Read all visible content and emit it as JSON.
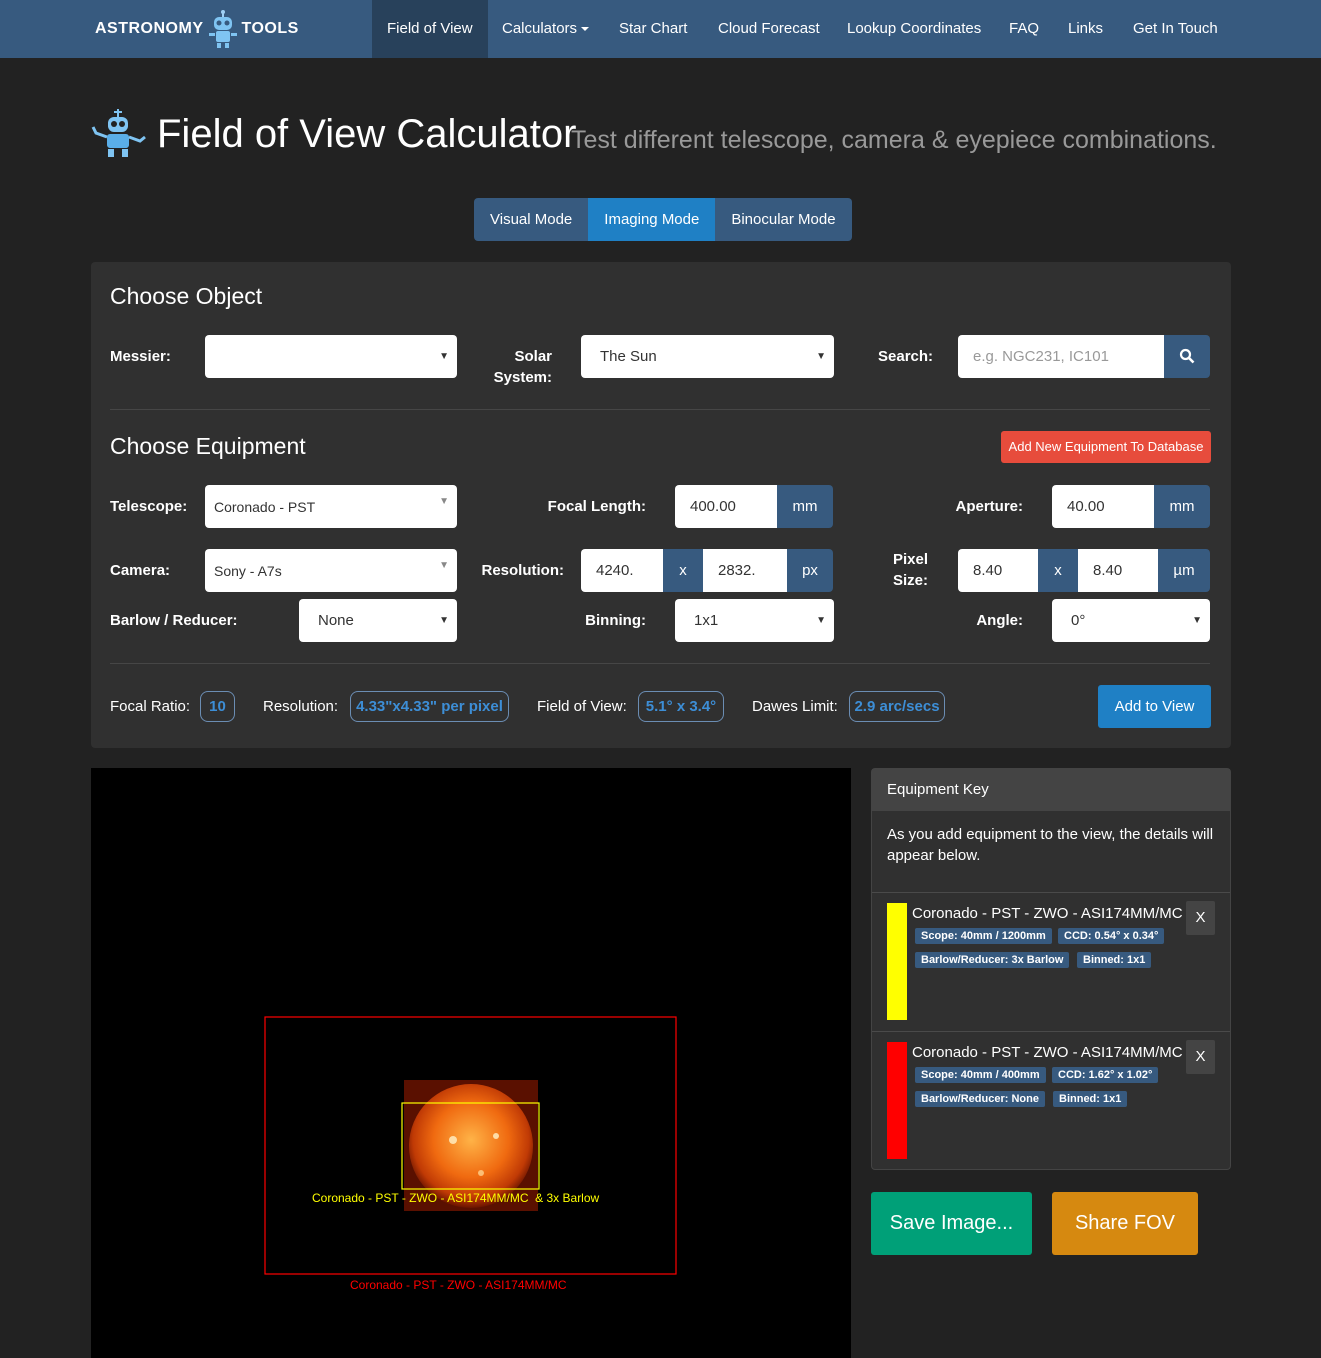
{
  "nav": {
    "brand_left": "ASTRONOMY",
    "brand_right": "TOOLS",
    "items": [
      {
        "label": "Field of View"
      },
      {
        "label": "Calculators"
      },
      {
        "label": "Star Chart"
      },
      {
        "label": "Cloud Forecast"
      },
      {
        "label": "Lookup Coordinates"
      },
      {
        "label": "FAQ"
      },
      {
        "label": "Links"
      },
      {
        "label": "Get In Touch"
      }
    ]
  },
  "header": {
    "title": "Field of View Calculator",
    "subtitle": "Test different telescope, camera & eyepiece combinations."
  },
  "modes": [
    "Visual Mode",
    "Imaging Mode",
    "Binocular Mode"
  ],
  "object": {
    "heading": "Choose Object",
    "messier_label": "Messier:",
    "messier_value": "",
    "solar_label_1": "Solar",
    "solar_label_2": "System:",
    "solar_value": "The Sun",
    "search_label": "Search:",
    "search_placeholder": "e.g. NGC231, IC101"
  },
  "equipment": {
    "heading": "Choose Equipment",
    "add_db_button": "Add New Equipment To Database",
    "telescope_label": "Telescope:",
    "telescope_value": "Coronado - PST",
    "focal_length_label": "Focal Length:",
    "focal_length_value": "400.00",
    "focal_length_unit": "mm",
    "aperture_label": "Aperture:",
    "aperture_value": "40.00",
    "aperture_unit": "mm",
    "camera_label": "Camera:",
    "camera_value": "Sony - A7s",
    "resolution_label": "Resolution:",
    "resolution_w": "4240.",
    "resolution_x": "x",
    "resolution_h": "2832.",
    "resolution_unit": "px",
    "pixel_label_1": "Pixel",
    "pixel_label_2": "Size:",
    "pixel_w": "8.40",
    "pixel_x": "x",
    "pixel_h": "8.40",
    "pixel_unit": "µm",
    "barlow_label": "Barlow / Reducer:",
    "barlow_value": "None",
    "binning_label": "Binning:",
    "binning_value": "1x1",
    "angle_label": "Angle:",
    "angle_value": "0°"
  },
  "results": {
    "focal_ratio_label": "Focal Ratio:",
    "focal_ratio_value": "10",
    "resolution_label": "Resolution:",
    "resolution_value": "4.33\"x4.33\" per pixel",
    "fov_label": "Field of View:",
    "fov_value": "5.1° x 3.4°",
    "dawes_label": "Dawes Limit:",
    "dawes_value": "2.9 arc/secs",
    "add_button": "Add to View"
  },
  "view": {
    "yellow_label": "Coronado - PST - ZWO - ASI174MM/MC  & 3x Barlow",
    "red_label": "Coronado - PST - ZWO - ASI174MM/MC",
    "yellow_color": "#ffff00",
    "red_color": "#ff0000"
  },
  "key": {
    "heading": "Equipment Key",
    "intro": "As you add equipment to the view, the details will appear below.",
    "entries": [
      {
        "name": "Coronado - PST - ZWO - ASI174MM/MC",
        "scope": "Scope: 40mm / 1200mm",
        "ccd": "CCD: 0.54° x 0.34°",
        "barlow": "Barlow/Reducer: 3x Barlow",
        "binned": "Binned: 1x1",
        "remove": "X",
        "color": "#ffff00"
      },
      {
        "name": "Coronado - PST - ZWO - ASI174MM/MC",
        "scope": "Scope: 40mm / 400mm",
        "ccd": "CCD: 1.62° x 1.02°",
        "barlow": "Barlow/Reducer: None",
        "binned": "Binned: 1x1",
        "remove": "X",
        "color": "#ff0000"
      }
    ]
  },
  "actions": {
    "save": "Save Image...",
    "share": "Share FOV"
  }
}
